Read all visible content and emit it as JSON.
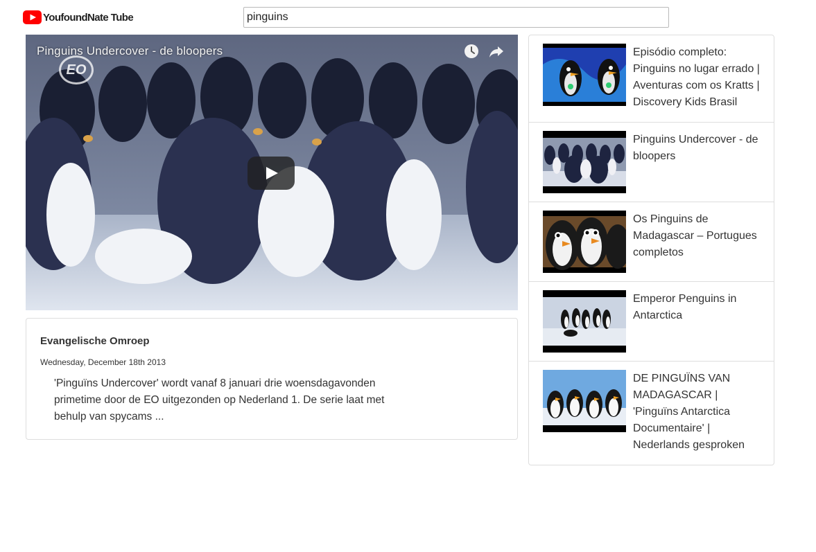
{
  "app": {
    "name": "YoufoundNate Tube",
    "logo_icon": "youtube-play-icon",
    "brand_color": "#ff0000"
  },
  "search": {
    "value": "pinguins"
  },
  "player": {
    "title": "Pinguins Undercover - de bloopers",
    "watermark": "EO",
    "controls": [
      "watch-later-icon",
      "share-icon",
      "play-icon"
    ]
  },
  "video_info": {
    "channel": "Evangelische Omroep",
    "date": "Wednesday, December 18th 2013",
    "description": "'Pinguïns Undercover' wordt vanaf 8 januari drie woensdagavonden primetime door de EO uitgezonden op Nederland 1. De serie laat met behulp van spycams ..."
  },
  "results": [
    {
      "title": "Episódio completo: Pinguins no lugar errado | Aventuras com os Kratts | Discovery Kids Brasil"
    },
    {
      "title": "Pinguins Undercover - de bloopers"
    },
    {
      "title": "Os Pinguins de Madagascar – Portugues completos"
    },
    {
      "title": "Emperor Penguins in Antarctica"
    },
    {
      "title": "DE PINGUÏNS VAN MADAGASCAR | 'Pinguïns Antarctica Documentaire' | Nederlands gesproken"
    }
  ]
}
